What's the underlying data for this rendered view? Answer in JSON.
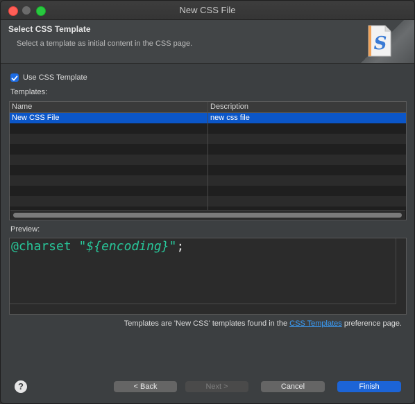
{
  "window": {
    "title": "New CSS File"
  },
  "header": {
    "title": "Select CSS Template",
    "subtitle": "Select a template as initial content in the CSS page.",
    "icon": "css-file-icon"
  },
  "use_template": {
    "label": "Use CSS Template",
    "checked": true
  },
  "templates": {
    "label": "Templates:",
    "columns": [
      "Name",
      "Description"
    ],
    "rows": [
      {
        "name": "New CSS File",
        "description": "new css file",
        "selected": true
      }
    ]
  },
  "preview": {
    "label": "Preview:",
    "code": {
      "keyword": "@charset",
      "string_open": "\"",
      "variable": "${encoding}",
      "string_close": "\"",
      "terminator": ";"
    }
  },
  "footer": {
    "note_prefix": "Templates are 'New CSS' templates found in the ",
    "link": "CSS Templates",
    "note_suffix": " preference page."
  },
  "buttons": {
    "help": "?",
    "back": "< Back",
    "next": "Next >",
    "cancel": "Cancel",
    "finish": "Finish"
  },
  "colors": {
    "selection": "#0b56c8",
    "accent": "#1c64d6",
    "code": "#28c79a",
    "link": "#3aa0ff"
  }
}
